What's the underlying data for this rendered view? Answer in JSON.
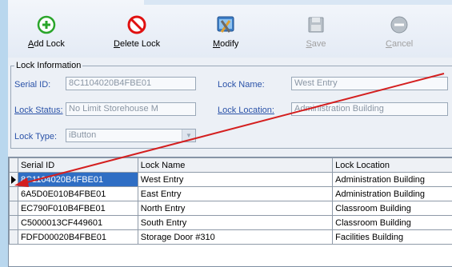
{
  "toolbar": {
    "add_label": "Add Lock",
    "delete_label": "Delete Lock",
    "modify_label": "Modify",
    "save_label": "Save",
    "cancel_label": "Cancel"
  },
  "info": {
    "legend": "Lock Information",
    "serial_label": "Serial ID:",
    "serial_value": "8C1104020B4FBE01",
    "lock_name_label": "Lock Name:",
    "lock_name_value": "West Entry",
    "status_label": "Lock Status:",
    "status_value": "No Limit Storehouse M",
    "location_label": "Lock Location:",
    "location_value": "Administration Building",
    "type_label": "Lock Type:",
    "type_value": "iButton"
  },
  "grid": {
    "headers": [
      "Serial ID",
      "Lock Name",
      "Lock Location"
    ],
    "rows": [
      [
        "8C1104020B4FBE01",
        "West Entry",
        "Administration Building"
      ],
      [
        "6A5D0E010B4FBE01",
        "East Entry",
        "Administration Building"
      ],
      [
        "EC790F010B4FBE01",
        "North Entry",
        "Classroom Building"
      ],
      [
        "C5000013CF449601",
        "South Entry",
        "Classroom Building"
      ],
      [
        "FDFD00020B4FBE01",
        "Storage Door #310",
        "Facilities Building"
      ]
    ]
  },
  "colors": {
    "accent_arrow": "#d41f1f",
    "selection": "#2f6ec4",
    "add_icon": "#2aa52a",
    "delete_icon": "#e01010"
  },
  "icons": {
    "add": "plus-circle-icon",
    "delete": "no-entry-icon",
    "modify": "tools-icon",
    "save": "floppy-disk-icon",
    "cancel": "minus-circle-icon"
  }
}
